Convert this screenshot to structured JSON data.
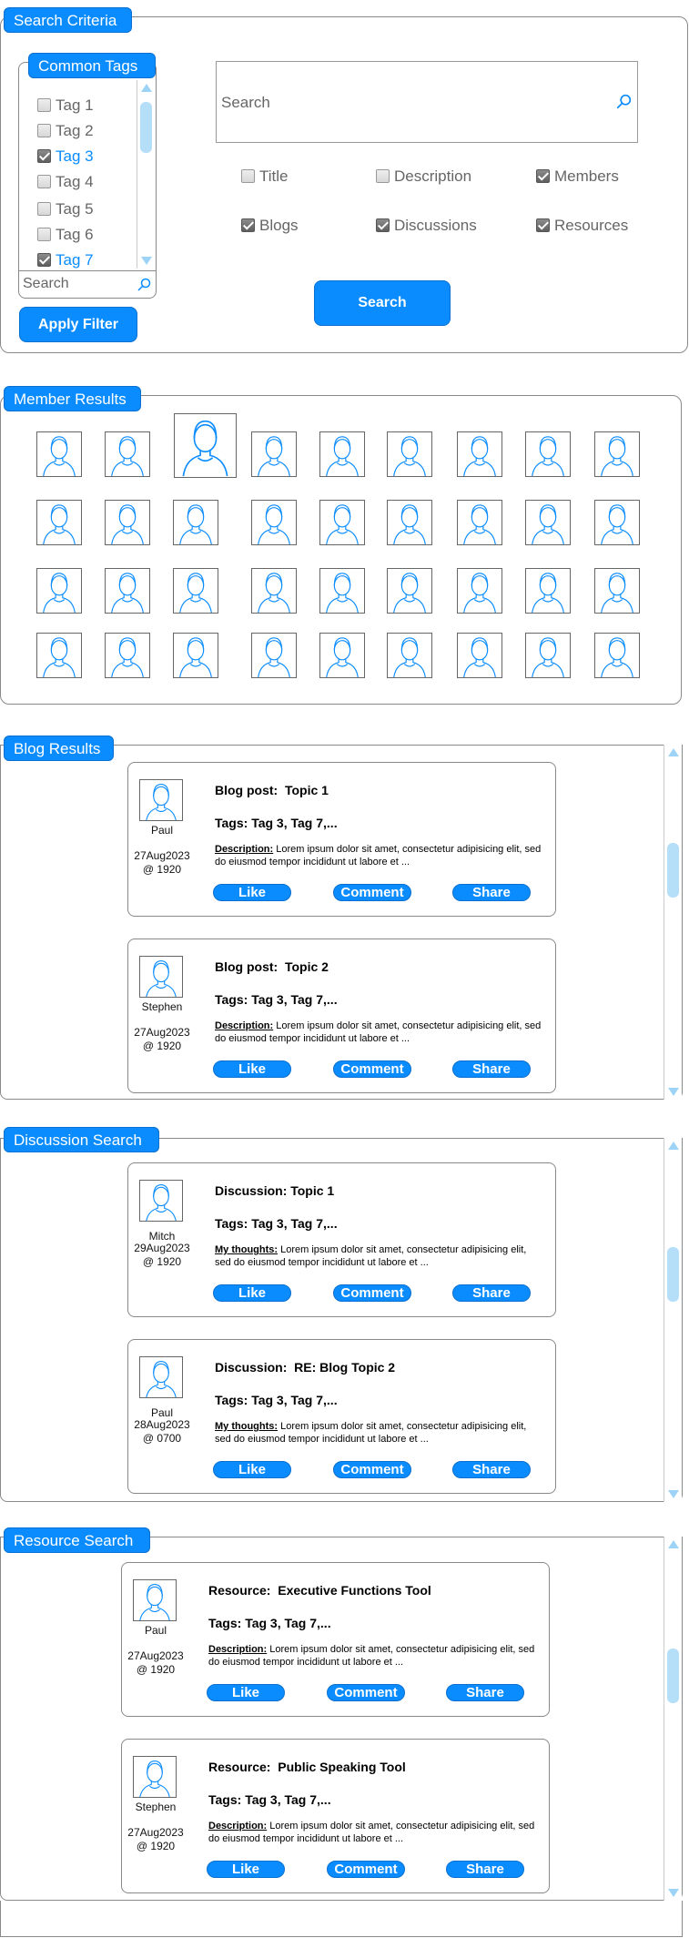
{
  "search_criteria": {
    "title": "Search Criteria",
    "common_tags": {
      "title": "Common Tags",
      "tags": [
        {
          "label": "Tag 1",
          "checked": false
        },
        {
          "label": "Tag 2",
          "checked": false
        },
        {
          "label": "Tag 3",
          "checked": true
        },
        {
          "label": "Tag 4",
          "checked": false
        },
        {
          "label": "Tag 5",
          "checked": false
        },
        {
          "label": "Tag 6",
          "checked": false
        },
        {
          "label": "Tag 7",
          "checked": true
        }
      ],
      "search_placeholder": "Search"
    },
    "apply_filter": "Apply Filter",
    "search_placeholder": "Search",
    "filters": [
      {
        "label": "Title",
        "checked": false
      },
      {
        "label": "Description",
        "checked": false
      },
      {
        "label": "Members",
        "checked": true
      },
      {
        "label": "Blogs",
        "checked": true
      },
      {
        "label": "Discussions",
        "checked": true
      },
      {
        "label": "Resources",
        "checked": true
      }
    ],
    "search_button": "Search"
  },
  "member_results": {
    "title": "Member Results",
    "rows": 4,
    "cols": 9
  },
  "blog_results": {
    "title": "Blog Results",
    "items": [
      {
        "name": "Paul",
        "date": "27Aug2023",
        "time": "@ 1920",
        "title": "Blog post:  Topic 1",
        "tags": "Tags: Tag 3, Tag 7,...",
        "desc_label": "Description:",
        "desc": " Lorem ipsum dolor sit amet, consectetur adipisicing elit, sed do eiusmod tempor incididunt ut labore et ..."
      },
      {
        "name": "Stephen",
        "date": "27Aug2023",
        "time": "@ 1920",
        "title": "Blog post:  Topic 2",
        "tags": "Tags: Tag 3, Tag 7,...",
        "desc_label": "Description:",
        "desc": " Lorem ipsum dolor sit amet, consectetur adipisicing elit, sed do eiusmod tempor incididunt ut labore et ..."
      }
    ]
  },
  "discussion_search": {
    "title": "Discussion Search",
    "items": [
      {
        "name": "Mitch",
        "date": "29Aug2023",
        "time": "@ 1920",
        "title": "Discussion: Topic 1",
        "tags": "Tags: Tag 3, Tag 7,...",
        "desc_label": "My thoughts:",
        "desc": " Lorem ipsum dolor sit amet, consectetur adipisicing elit, sed do eiusmod tempor incididunt ut labore et ..."
      },
      {
        "name": "Paul",
        "date": "28Aug2023",
        "time": "@ 0700",
        "title": "Discussion:  RE: Blog Topic 2",
        "tags": "Tags: Tag 3, Tag 7,...",
        "desc_label": "My thoughts:",
        "desc": " Lorem ipsum dolor sit amet, consectetur adipisicing elit, sed do eiusmod tempor incididunt ut labore et ..."
      }
    ]
  },
  "resource_search": {
    "title": "Resource Search",
    "items": [
      {
        "name": "Paul",
        "date": "27Aug2023",
        "time": "@ 1920",
        "title": "Resource:  Executive Functions Tool",
        "tags": "Tags: Tag 3, Tag 7,...",
        "desc_label": "Description:",
        "desc": " Lorem ipsum dolor sit amet, consectetur adipisicing elit, sed do eiusmod tempor incididunt ut labore et ..."
      },
      {
        "name": "Stephen",
        "date": "27Aug2023",
        "time": "@ 1920",
        "title": "Resource:  Public Speaking Tool",
        "tags": "Tags: Tag 3, Tag 7,...",
        "desc_label": "Description:",
        "desc": " Lorem ipsum dolor sit amet, consectetur adipisicing elit, sed do eiusmod tempor incididunt ut labore et ..."
      }
    ]
  },
  "actions": {
    "like": "Like",
    "comment": "Comment",
    "share": "Share"
  },
  "icons": {
    "search": "search-icon",
    "avatar": "person-avatar-icon",
    "checkmark": "checkmark-icon"
  },
  "colors": {
    "accent": "#0a8cff",
    "accent_light": "#9cd3f7"
  }
}
